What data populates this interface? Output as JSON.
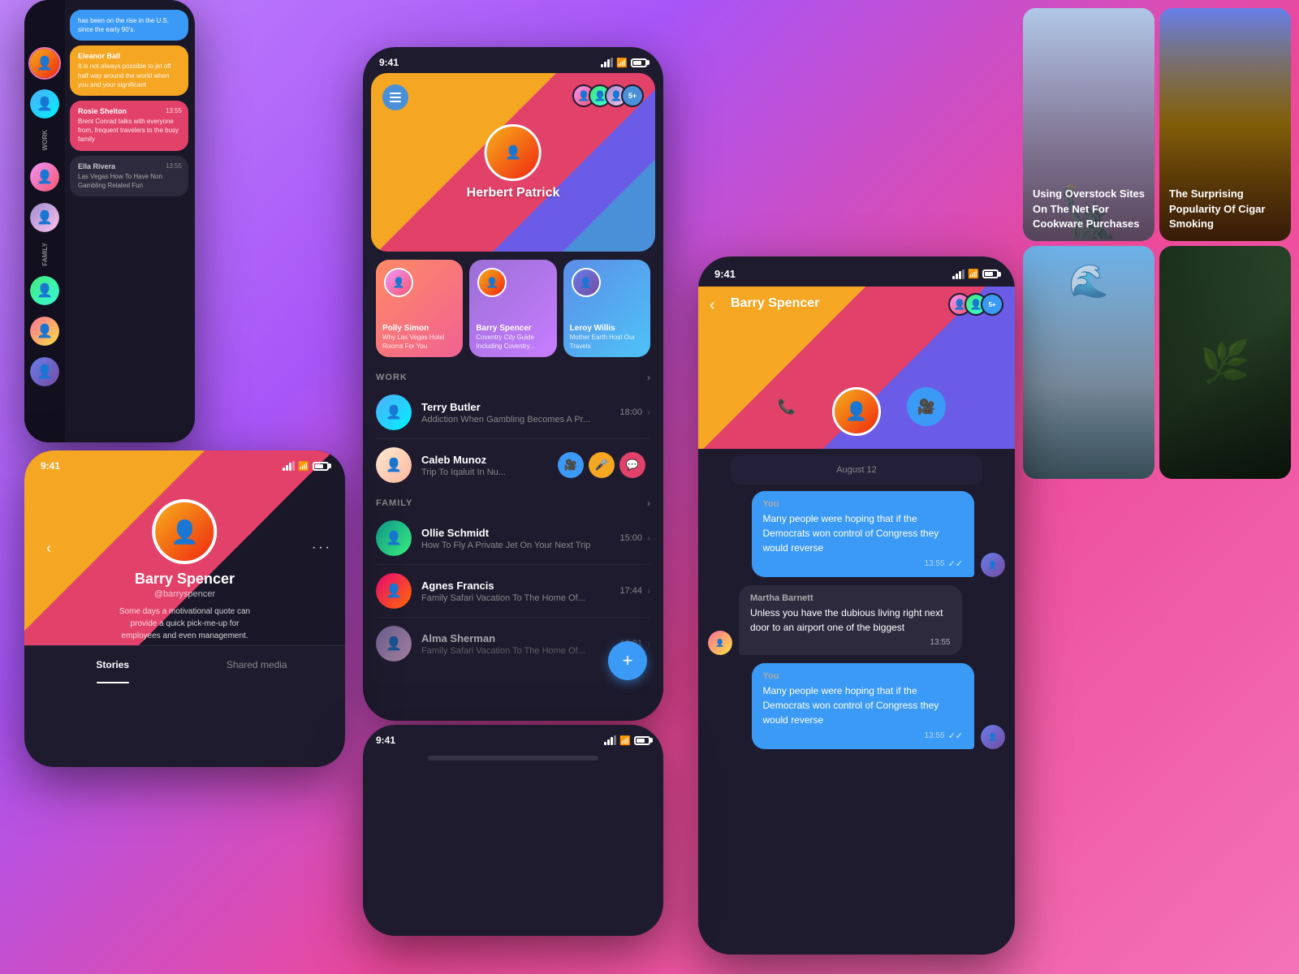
{
  "phone_left": {
    "top_bubble_text": "has been on the rise in the U.S. since the early 90's.",
    "section_work": "WORK",
    "section_family": "FAMILY",
    "messages": [
      {
        "sender": "Eleanor Ball",
        "time": "",
        "text": "It is not always possible to jet off half way around the world when you and your significant",
        "color": "yellow"
      },
      {
        "sender": "Rosie Shelton",
        "time": "13:55",
        "text": "Brent Conrad talks with everyone from, frequent travelers to the busy family",
        "color": "pink"
      },
      {
        "sender": "Ella Rivera",
        "time": "13:55",
        "text": "Las Vegas How To Have Non Gambling Related Fun",
        "color": "gray"
      }
    ]
  },
  "phone_center": {
    "time": "9:41",
    "hero_name": "Herbert Patrick",
    "badge_count": "5+",
    "section_work": "WORK",
    "section_family": "FAMILY",
    "stories": [
      {
        "name": "Polly Simon",
        "desc": "Why Las Vegas Hotel Rooms For You"
      },
      {
        "name": "Barry Spencer",
        "desc": "Coventry City Guide Including Coventry..."
      },
      {
        "name": "Leroy Willis",
        "desc": "Mother Earth Host Our Travels"
      }
    ],
    "work_contacts": [
      {
        "name": "Terry Butler",
        "time": "18:00",
        "msg": "Addiction When Gambling Becomes A Pr..."
      },
      {
        "name": "Caleb Munoz",
        "time": "",
        "msg": "Trip To Iqaluit In Nu..."
      }
    ],
    "family_contacts": [
      {
        "name": "Ollie Schmidt",
        "time": "15:00",
        "msg": "How To Fly A Private Jet On Your Next Trip"
      },
      {
        "name": "Agnes Francis",
        "time": "17:44",
        "msg": "Family Safari Vacation To The Home Of..."
      },
      {
        "name": "Alma Sherman",
        "time": "13:21",
        "msg": "Family Safari Vacation To The Home Of..."
      }
    ]
  },
  "phone_profile": {
    "time": "9:41",
    "name": "Barry Spencer",
    "username": "@barryspencer",
    "quote": "Some days a motivational quote can provide a quick pick-me-up for employees and even management.",
    "tab_stories": "Stories",
    "tab_shared": "Shared media"
  },
  "phone_chat": {
    "time": "9:41",
    "contact_name": "Barry Spencer",
    "badge_count": "5+",
    "date_sep": "August 12",
    "messages": [
      {
        "is_self": true,
        "sender": "You",
        "time": "13:55",
        "text": "Many people were hoping that if the Democrats won control of Congress they would reverse"
      },
      {
        "is_self": false,
        "sender": "Martha Barnett",
        "time": "13:55",
        "text": "Unless you have the dubious living right next door to an airport one of the biggest"
      },
      {
        "is_self": true,
        "sender": "You",
        "time": "13:55",
        "text": "Many people were hoping that if the Democrats won control of Congress they would reverse"
      }
    ]
  },
  "news": {
    "card1_title": "Using Overstock Sites On The Net For Cookware Purchases",
    "card2_title": "The Surprising Popularity Of Cigar Smoking",
    "card3_title": "",
    "card4_title": ""
  }
}
